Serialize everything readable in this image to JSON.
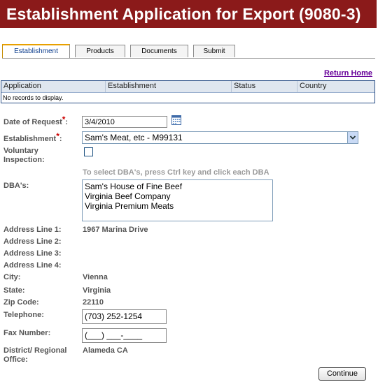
{
  "page": {
    "title": "Establishment Application for Export (9080-3)"
  },
  "tabs": [
    {
      "label": "Establishment"
    },
    {
      "label": "Products"
    },
    {
      "label": "Documents"
    },
    {
      "label": "Submit"
    }
  ],
  "return_home": "Return Home",
  "grid": {
    "columns": [
      "Application",
      "Establishment",
      "Status",
      "Country"
    ],
    "empty_text": "No records to display."
  },
  "form": {
    "date_of_request": {
      "label": "Date of Request",
      "value": "3/4/2010",
      "required": "*"
    },
    "establishment": {
      "label": "Establishment",
      "value": "Sam's Meat, etc - M99131",
      "required": "*"
    },
    "voluntary_inspection": {
      "label_line1": "Voluntary",
      "label_line2": "Inspection:"
    },
    "dba_hint": "To select DBA's, press Ctrl key and click each DBA",
    "dbas": {
      "label": "DBA's:",
      "options": [
        "Sam's House of Fine Beef",
        "Virginia Beef Company",
        "Virginia Premium Meats"
      ]
    },
    "address_line_1": {
      "label": "Address Line 1:",
      "value": "1967 Marina Drive"
    },
    "address_line_2": {
      "label": "Address Line 2:"
    },
    "address_line_3": {
      "label": "Address Line 3:"
    },
    "address_line_4": {
      "label": "Address Line 4:"
    },
    "city": {
      "label": "City:",
      "value": "Vienna"
    },
    "state": {
      "label": "State:",
      "value": "Virginia"
    },
    "zip": {
      "label": "Zip Code:",
      "value": "22110"
    },
    "telephone": {
      "label": "Telephone:",
      "value": "(703) 252-1254"
    },
    "fax": {
      "label": "Fax Number:",
      "value": "(___) ___-____"
    },
    "district": {
      "label_line1": "District/ Regional",
      "label_line2": "Office:",
      "value": "Alameda CA"
    }
  },
  "continue_label": "Continue",
  "colors": {
    "banner": "#8b1a1a",
    "tab_accent": "#e8a000",
    "link": "#660099",
    "required": "#cc0000"
  }
}
